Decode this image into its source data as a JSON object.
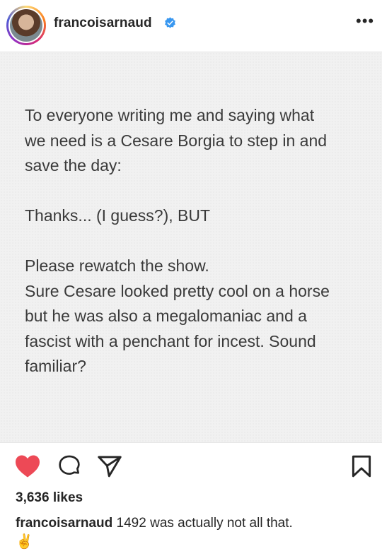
{
  "post": {
    "username": "francoisarnaud",
    "verified": true,
    "more_icon": "more-horizontal-icon",
    "image_text": {
      "para1": "To everyone writing me and saying what\nwe need is a Cesare Borgia to step in and\nsave the day:",
      "para2": "Thanks... (I guess?), BUT",
      "para3": "Please rewatch the show.\nSure Cesare looked pretty cool on a horse\nbut he was also a megalomaniac and a\nfascist with a penchant for incest. Sound\nfamiliar?"
    },
    "actions": {
      "like_icon": "heart-filled-icon",
      "comment_icon": "comment-icon",
      "share_icon": "share-paper-plane-icon",
      "save_icon": "bookmark-icon"
    },
    "likes": "3,636 likes",
    "caption_user": "francoisarnaud",
    "caption_text": "1492 was actually not all that.",
    "caption_emoji": "✌️"
  },
  "colors": {
    "like": "#ed4956",
    "verified": "#3897f0",
    "text": "#262626"
  }
}
